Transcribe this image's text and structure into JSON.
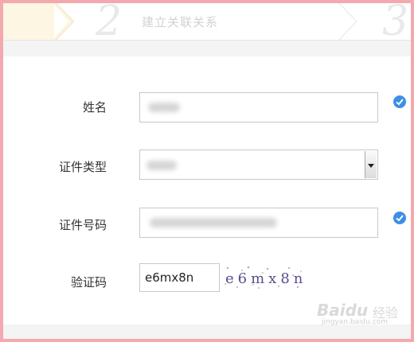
{
  "steps": [
    {
      "number": "2",
      "label": "建立关联关系"
    },
    {
      "number": "3",
      "label": ""
    }
  ],
  "form": {
    "name": {
      "label": "姓名",
      "value": "",
      "verified": true
    },
    "id_type": {
      "label": "证件类型",
      "value": ""
    },
    "id_number": {
      "label": "证件号码",
      "value": "",
      "verified": true
    },
    "captcha": {
      "label": "验证码",
      "value": "e6mx8n",
      "image_text": "e6mx8n"
    }
  },
  "watermark": {
    "logo": "Baidu",
    "sub": "经验",
    "url": "jingyan.baidu.com"
  },
  "colors": {
    "border": "#f3a9ad",
    "check": "#3d8fe6",
    "step_highlight": "#fdf6e3"
  }
}
